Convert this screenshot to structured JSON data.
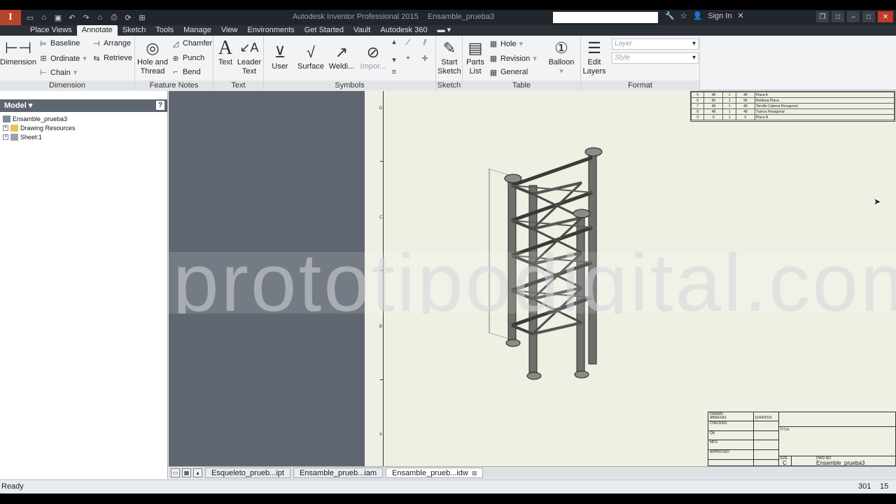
{
  "app": {
    "logo_letter": "I",
    "window_title": "Autodesk Inventor Professional 2015",
    "document_title": "Ensamble_prueba3",
    "sign_in": "Sign In"
  },
  "ribbon_tabs": [
    "Place Views",
    "Annotate",
    "Sketch",
    "Tools",
    "Manage",
    "View",
    "Environments",
    "Get Started",
    "Vault",
    "Autodesk 360"
  ],
  "active_tab": "Annotate",
  "ribbon": {
    "dimension": {
      "label": "Dimension",
      "big": "Dimension",
      "baseline": "Baseline",
      "ordinate": "Ordinate",
      "chain": "Chain",
      "arrange": "Arrange",
      "retrieve": "Retrieve"
    },
    "feature_notes": {
      "label": "Feature Notes",
      "hole_thread": "Hole and Thread",
      "chamfer": "Chamfer",
      "punch": "Punch",
      "bend": "Bend"
    },
    "text": {
      "label": "Text",
      "text": "Text",
      "leader_text": "Leader Text"
    },
    "symbols": {
      "label": "Symbols",
      "user": "User",
      "surface": "Surface",
      "welding": "Weldi...",
      "import": "Impor..."
    },
    "sketch": {
      "label": "Sketch",
      "start_sketch": "Start Sketch"
    },
    "table": {
      "label": "Table",
      "parts_list": "Parts List",
      "hole": "Hole",
      "revision": "Revision",
      "general": "General"
    },
    "balloon": {
      "label": "Balloon"
    },
    "format": {
      "label": "Format",
      "edit_layers": "Edit Layers",
      "layer_placeholder": "Layer",
      "style_placeholder": "Style"
    }
  },
  "browser": {
    "title": "Model",
    "help": "?",
    "tree": [
      {
        "label": "Ensamble_prueba3",
        "level": 0
      },
      {
        "label": "Drawing Resources",
        "level": 1
      },
      {
        "label": "Sheet:1",
        "level": 1
      }
    ]
  },
  "drawing": {
    "zones": [
      "D",
      "C",
      "B",
      "A"
    ],
    "parts_list": [
      {
        "item": "5",
        "qty": "48",
        "unit": "1",
        "total": "48",
        "desc": "Placa A"
      },
      {
        "item": "6",
        "qty": "96",
        "unit": "1",
        "total": "96",
        "desc": "Roldana Plana"
      },
      {
        "item": "7",
        "qty": "48",
        "unit": "1",
        "total": "48",
        "desc": "Tornillo Cabeza Hexagonal"
      },
      {
        "item": "8",
        "qty": "48",
        "unit": "1",
        "total": "48",
        "desc": "Tuerca Hexagonal"
      },
      {
        "item": "9",
        "qty": "6",
        "unit": "1",
        "total": "6",
        "desc": "Placa B"
      }
    ],
    "title_block": {
      "drawn": "DRAWN",
      "drawn_by": "ABRAXAS",
      "date": "11/04/2015",
      "checked": "CHECKED",
      "qa": "QA",
      "mfg": "MFG",
      "approved": "APPROVED",
      "title": "TITLE",
      "size_label": "SIZE",
      "size": "C",
      "dwg_label": "DWG NO",
      "dwg_no": "Ensamble_prueba3"
    }
  },
  "watermark": "prototipodigital.com.mx",
  "doc_tabs": [
    {
      "label": "Esqueleto_prueb...ipt",
      "active": false
    },
    {
      "label": "Ensamble_prueb...iam",
      "active": false
    },
    {
      "label": "Ensamble_prueb...idw",
      "active": true
    }
  ],
  "status": {
    "text": "Ready",
    "x": "301",
    "y": "15"
  }
}
